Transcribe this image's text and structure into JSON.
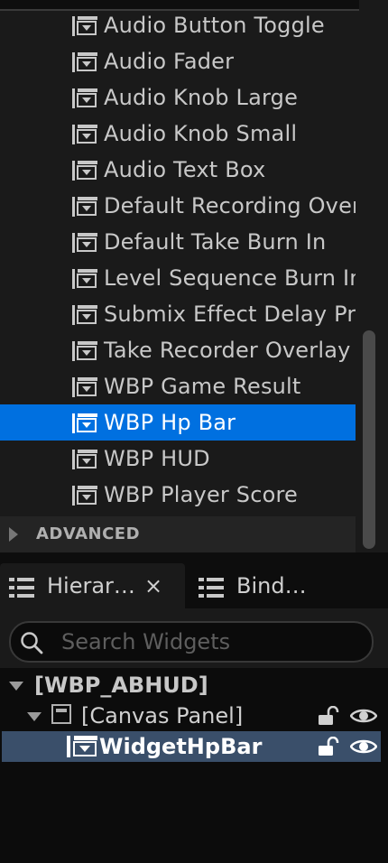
{
  "palette": {
    "items": [
      {
        "label": "Audio Button Toggle"
      },
      {
        "label": "Audio Fader"
      },
      {
        "label": "Audio Knob Large"
      },
      {
        "label": "Audio Knob Small"
      },
      {
        "label": "Audio Text Box"
      },
      {
        "label": "Default Recording Overl"
      },
      {
        "label": "Default Take Burn In"
      },
      {
        "label": "Level Sequence Burn In"
      },
      {
        "label": "Submix Effect Delay Pr"
      },
      {
        "label": "Take Recorder Overlay W"
      },
      {
        "label": "WBP Game Result"
      },
      {
        "label": "WBP Hp Bar",
        "selected": true
      },
      {
        "label": "WBP HUD"
      },
      {
        "label": "WBP Player Score"
      }
    ],
    "advanced_label": "ADVANCED"
  },
  "tabs": [
    {
      "label": "Hierar…",
      "close": "×",
      "active": true,
      "icon": "list-icon"
    },
    {
      "label": "Bind…",
      "active": false,
      "icon": "list-icon"
    }
  ],
  "hierarchy": {
    "search_placeholder": "Search Widgets",
    "search_value": "",
    "tree": [
      {
        "label": "[WBP_ABHUD]",
        "expanded": true
      },
      {
        "label": "[Canvas Panel]",
        "expanded": true,
        "icon": "canvas-panel-icon"
      },
      {
        "label": "WidgetHpBar",
        "selected": true,
        "icon": "user-widget-icon"
      }
    ]
  },
  "colors": {
    "selection": "#0070e0",
    "tree_selection": "#3a4f6a",
    "background": "#1a1a1a"
  }
}
